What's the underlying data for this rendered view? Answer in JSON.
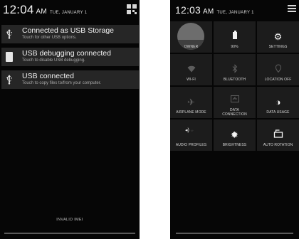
{
  "left_screen": {
    "status": {
      "time": "12:04",
      "ampm": "AM",
      "date": "TUE, JANUARY 1"
    },
    "notifications": [
      {
        "icon": "usb-icon",
        "title": "Connected as USB Storage",
        "subtitle": "Touch for other USB options."
      },
      {
        "icon": "debug-icon",
        "title": "USB debugging connected",
        "subtitle": "Touch to disable USB debugging."
      },
      {
        "icon": "usb-icon",
        "title": "USB connected",
        "subtitle": "Touch to copy files to/from your computer."
      }
    ],
    "bottom_label": "INVALID IMEI"
  },
  "right_screen": {
    "status": {
      "time": "12:03",
      "ampm": "AM",
      "date": "TUE, JANUARY 1"
    },
    "tiles": [
      {
        "label": "OWNER",
        "icon": "avatar-icon",
        "active": true
      },
      {
        "label": "90%",
        "icon": "battery-icon",
        "active": true
      },
      {
        "label": "SETTINGS",
        "icon": "gear-icon",
        "active": true
      },
      {
        "label": "WI-FI",
        "icon": "wifi-icon",
        "active": false
      },
      {
        "label": "BLUETOOTH",
        "icon": "bluetooth-icon",
        "active": false
      },
      {
        "label": "LOCATION OFF",
        "icon": "location-icon",
        "active": false
      },
      {
        "label": "AIRPLANE MODE",
        "icon": "airplane-icon",
        "active": false
      },
      {
        "label": "DATA CONNECTION",
        "icon": "data-connection-icon",
        "active": false
      },
      {
        "label": "DATA USAGE",
        "icon": "data-usage-icon",
        "active": true
      },
      {
        "label": "AUDIO PROFILES",
        "icon": "audio-profiles-icon",
        "active": true
      },
      {
        "label": "BRIGHTNESS",
        "icon": "brightness-icon",
        "active": true
      },
      {
        "label": "AUTO ROTATION",
        "icon": "auto-rotation-icon",
        "active": true
      }
    ]
  }
}
